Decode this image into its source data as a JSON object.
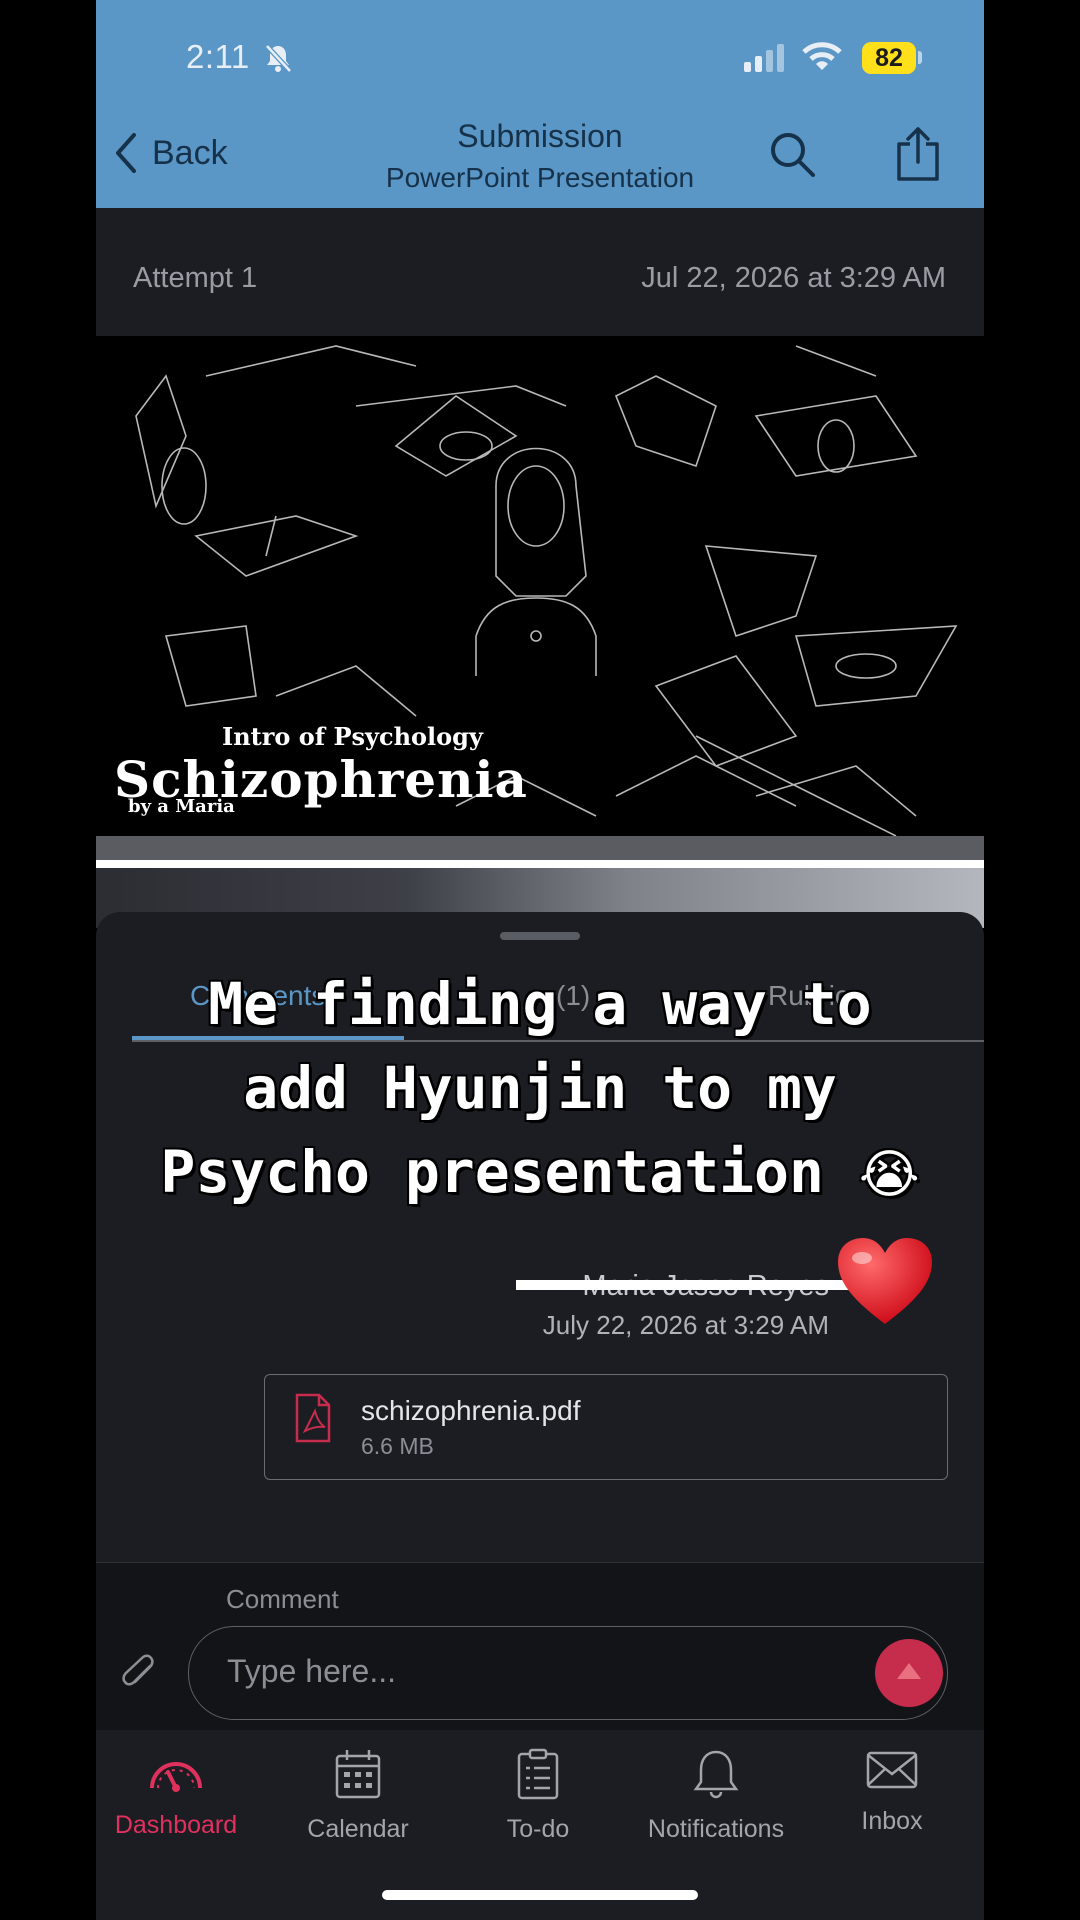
{
  "status_bar": {
    "time": "2:11",
    "battery": "82",
    "icons": [
      "bell-slash-icon",
      "signal-icon",
      "wifi-icon",
      "battery-icon"
    ]
  },
  "nav": {
    "back_label": "Back",
    "title": "Submission",
    "subtitle": "PowerPoint Presentation",
    "icons": [
      "chevron-left-icon",
      "search-icon",
      "share-icon"
    ]
  },
  "attempt": {
    "label": "Attempt 1",
    "date": "Jul 22, 2026 at 3:29 AM"
  },
  "slide": {
    "subtitle": "Intro of Psychology",
    "title": "Schizophrenia",
    "author": "by a Maria"
  },
  "sheet": {
    "tabs": [
      {
        "label": "Comments"
      },
      {
        "label": "(1)"
      },
      {
        "label": "Rubric"
      }
    ],
    "caption_line1": "Me finding a way to",
    "caption_line2": "add Hyunjin to my",
    "caption_line3": "Psycho presentation",
    "caption_emoji": "😭",
    "comment": {
      "author": "Maria Jasso Reyes",
      "date": "July 22, 2026 at 3:29 AM",
      "attachment_name": "schizophrenia.pdf",
      "attachment_size": "6.6 MB"
    }
  },
  "composer": {
    "label": "Comment",
    "placeholder": "Type here..."
  },
  "tabbar": {
    "items": [
      {
        "label": "Dashboard",
        "icon": "dashboard-icon",
        "active": true
      },
      {
        "label": "Calendar",
        "icon": "calendar-icon",
        "active": false
      },
      {
        "label": "To-do",
        "icon": "todo-icon",
        "active": false
      },
      {
        "label": "Notifications",
        "icon": "bell-icon",
        "active": false
      },
      {
        "label": "Inbox",
        "icon": "inbox-icon",
        "active": false
      }
    ]
  },
  "colors": {
    "header_bg": "#5a96c6",
    "accent_active": "#e0315e",
    "send_button": "#c62c4c",
    "battery_fill": "#ffe01b"
  }
}
